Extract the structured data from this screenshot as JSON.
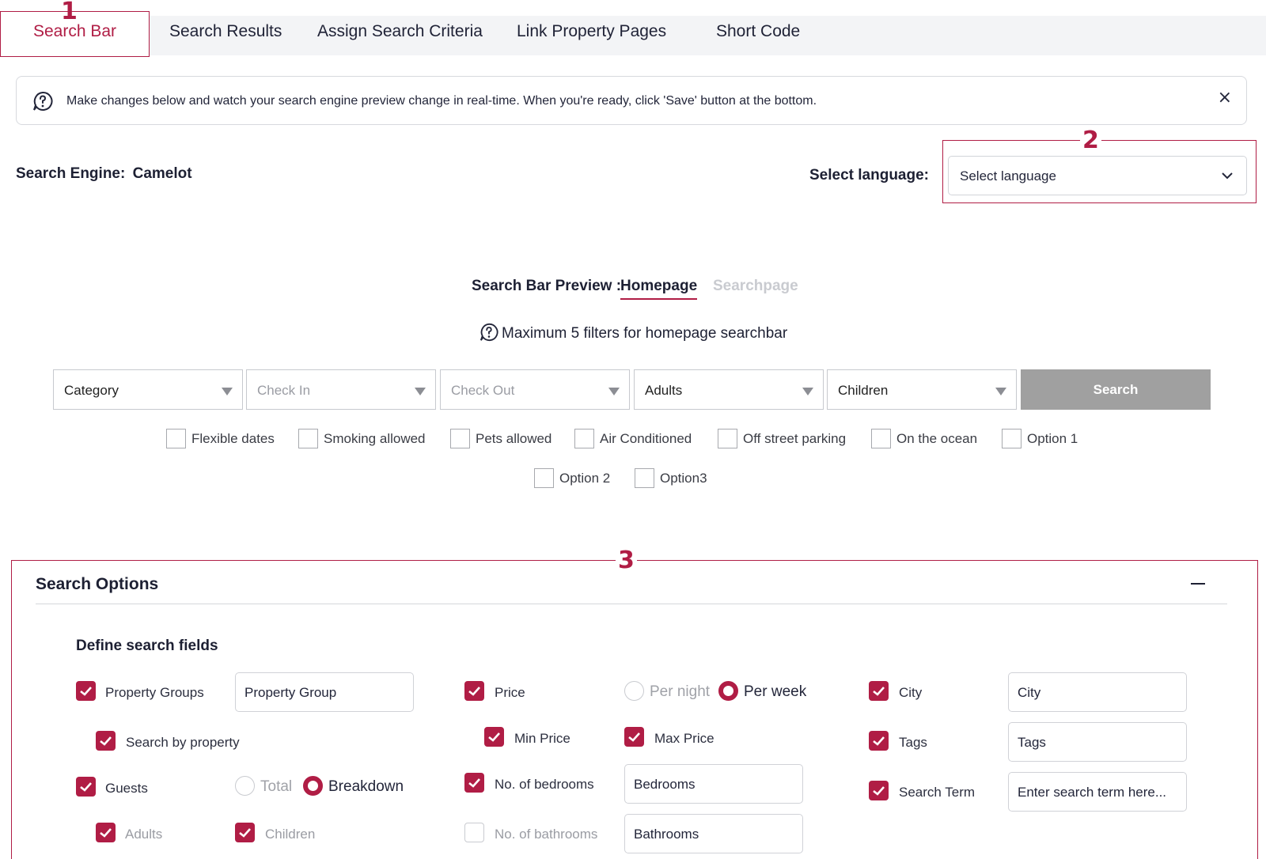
{
  "tabs": [
    {
      "label": "Search Bar",
      "active": true
    },
    {
      "label": "Search Results",
      "active": false
    },
    {
      "label": "Assign Search Criteria",
      "active": false
    },
    {
      "label": "Link Property Pages",
      "active": false
    },
    {
      "label": "Short Code",
      "active": false
    }
  ],
  "callouts": [
    "1",
    "2",
    "3"
  ],
  "banner": {
    "text": "Make changes below and watch your search engine preview change in real-time. When you're ready, click 'Save' button at the bottom.",
    "close_glyph": "×"
  },
  "engine": {
    "label": "Search Engine:",
    "name": "Camelot"
  },
  "language": {
    "label": "Select language:",
    "value": "Select language"
  },
  "preview": {
    "label": "Search Bar Preview :",
    "tabs": [
      "Homepage",
      "Searchpage"
    ],
    "note": "Maximum 5 filters for homepage searchbar",
    "fields": [
      "Category",
      "Check In",
      "Check Out",
      "Adults",
      "Children"
    ],
    "search_button": "Search",
    "checkboxes": [
      "Flexible dates",
      "Smoking allowed",
      "Pets allowed",
      "Air Conditioned",
      "Off street parking",
      "On the ocean",
      "Option 1",
      "Option 2",
      "Option3"
    ]
  },
  "options": {
    "title": "Search Options",
    "section": "Define search fields",
    "property_groups": {
      "label": "Property Groups",
      "value": "Property Group"
    },
    "search_by_property": "Search by property",
    "guests": {
      "label": "Guests",
      "total": "Total",
      "breakdown": "Breakdown"
    },
    "adults": "Adults",
    "children": "Children",
    "price": {
      "label": "Price",
      "per_night": "Per night",
      "per_week": "Per week"
    },
    "min_price": "Min Price",
    "max_price": "Max Price",
    "bedrooms": {
      "label": "No. of bedrooms",
      "value": "Bedrooms"
    },
    "bathrooms": {
      "label": "No. of bathrooms",
      "value": "Bathrooms"
    },
    "city": {
      "label": "City",
      "value": "City"
    },
    "tags": {
      "label": "Tags",
      "value": "Tags"
    },
    "search_term": {
      "label": "Search Term",
      "placeholder": "Enter search term here..."
    }
  },
  "colors": {
    "accent": "#b01d45",
    "search_button": "#a0a0a0"
  },
  "icons": [
    "question-circle-icon",
    "close-icon",
    "chevron-down-icon",
    "dropdown-triangle-icon",
    "checkmark-icon",
    "collapse-minus-icon"
  ]
}
